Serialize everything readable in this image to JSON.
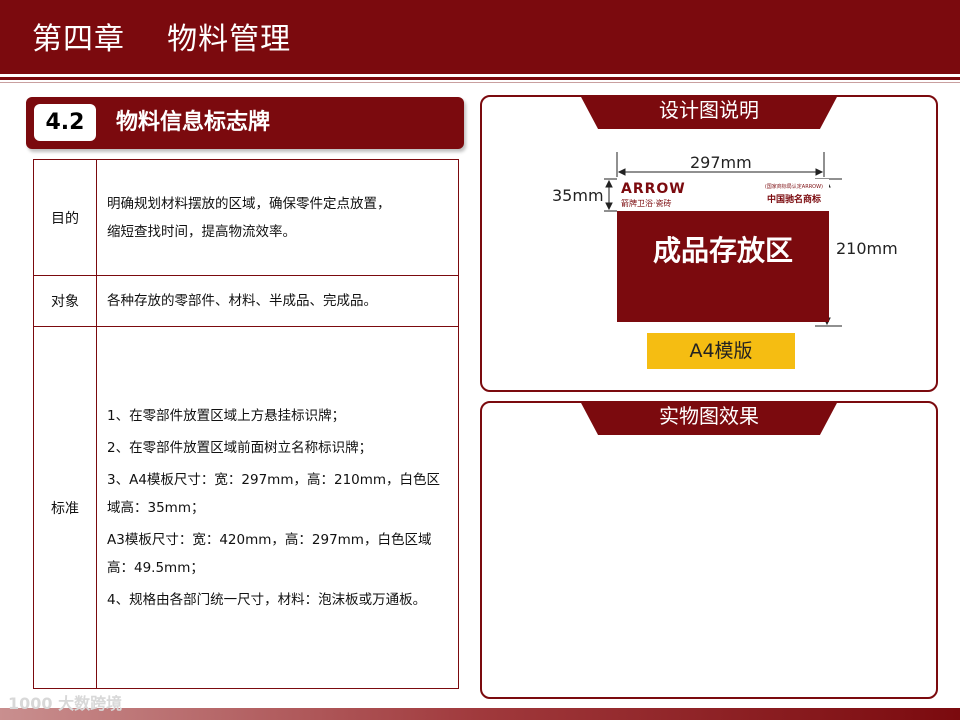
{
  "header": {
    "title": "第四章    物料管理"
  },
  "section": {
    "number": "4.2",
    "title": "物料信息标志牌"
  },
  "table": {
    "purpose_label": "目的",
    "purpose_lines": [
      "明确规划材料摆放的区域，确保零件定点放置，",
      "缩短查找时间，提高物流效率。"
    ],
    "object_label": "对象",
    "object_text": "各种存放的零部件、材料、半成品、完成品。",
    "standard_label": "标准",
    "standard_items": [
      "1、在零部件放置区域上方悬挂标识牌；",
      "2、在零部件放置区域前面树立名称标识牌；",
      "3、A4模板尺寸：宽：297mm，高：210mm，白色区域高：35mm；",
      "A3模板尺寸：宽：420mm，高：297mm，白色区域高：49.5mm；",
      "4、规格由各部门统一尺寸，材料：泡沫板或万通板。"
    ]
  },
  "design_panel": {
    "title": "设计图说明",
    "width_label": "297mm",
    "white_height_label": "35mm",
    "height_label": "210mm",
    "brand": "ARROW",
    "brand_sub": "箭牌卫浴·瓷砖",
    "trademark_small": "(国家商标局认定ARROW)",
    "trademark_big": "中国驰名商标",
    "sign_text": "成品存放区",
    "template_label": "A4模版"
  },
  "effect_panel": {
    "title": "实物图效果"
  },
  "watermark": "1000 大数跨境",
  "colors": {
    "brand_red": "#7b0a0e",
    "template_yellow": "#f5bd12"
  }
}
